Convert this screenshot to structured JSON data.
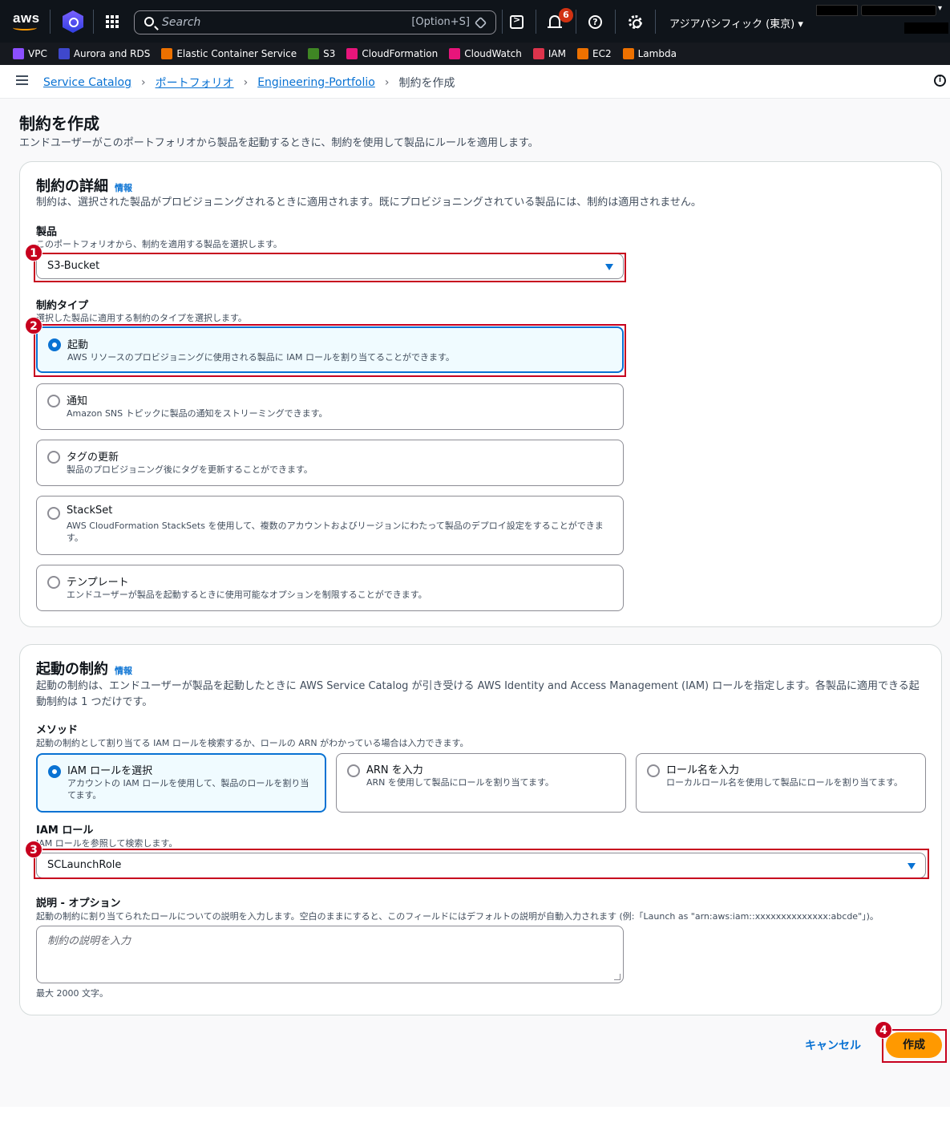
{
  "topnav": {
    "search_placeholder": "Search",
    "search_shortcut": "[Option+S]",
    "notification_count": "6",
    "region": "アジアパシフィック (東京) ▾"
  },
  "favorites": [
    {
      "label": "VPC",
      "color": "#8c4fff"
    },
    {
      "label": "Aurora and RDS",
      "color": "#3f48cc"
    },
    {
      "label": "Elastic Container Service",
      "color": "#ed7100"
    },
    {
      "label": "S3",
      "color": "#3f8624"
    },
    {
      "label": "CloudFormation",
      "color": "#e7157b"
    },
    {
      "label": "CloudWatch",
      "color": "#e7157b"
    },
    {
      "label": "IAM",
      "color": "#dd344c"
    },
    {
      "label": "EC2",
      "color": "#ed7100"
    },
    {
      "label": "Lambda",
      "color": "#ed7100"
    }
  ],
  "breadcrumb": {
    "item1": "Service Catalog",
    "item2": "ポートフォリオ",
    "item3": "Engineering-Portfolio",
    "current": "制約を作成"
  },
  "page": {
    "title": "制約を作成",
    "description": "エンドユーザーがこのポートフォリオから製品を起動するときに、制約を使用して製品にルールを適用します。"
  },
  "details": {
    "heading": "制約の詳細",
    "info": "情報",
    "description": "制約は、選択された製品がプロビジョニングされるときに適用されます。既にプロビジョニングされている製品には、制約は適用されません。",
    "product_label": "製品",
    "product_sublabel": "このポートフォリオから、制約を適用する製品を選択します。",
    "product_value": "S3-Bucket",
    "type_label": "制約タイプ",
    "type_sublabel": "選択した製品に適用する制約のタイプを選択します。",
    "types": [
      {
        "title": "起動",
        "desc": "AWS リソースのプロビジョニングに使用される製品に IAM ロールを割り当てることができます。"
      },
      {
        "title": "通知",
        "desc": "Amazon SNS トピックに製品の通知をストリーミングできます。"
      },
      {
        "title": "タグの更新",
        "desc": "製品のプロビジョニング後にタグを更新することができます。"
      },
      {
        "title": "StackSet",
        "desc": "AWS CloudFormation StackSets を使用して、複数のアカウントおよびリージョンにわたって製品のデプロイ設定をすることができます。"
      },
      {
        "title": "テンプレート",
        "desc": "エンドユーザーが製品を起動するときに使用可能なオプションを制限することができます。"
      }
    ]
  },
  "launch": {
    "heading": "起動の制約",
    "info": "情報",
    "description": "起動の制約は、エンドユーザーが製品を起動したときに AWS Service Catalog が引き受ける AWS Identity and Access Management (IAM) ロールを指定します。各製品に適用できる起動制約は 1 つだけです。",
    "method_label": "メソッド",
    "method_sublabel": "起動の制約として割り当てる IAM ロールを検索するか、ロールの ARN がわかっている場合は入力できます。",
    "methods": [
      {
        "title": "IAM ロールを選択",
        "desc": "アカウントの IAM ロールを使用して、製品のロールを割り当てます。"
      },
      {
        "title": "ARN を入力",
        "desc": "ARN を使用して製品にロールを割り当てます。"
      },
      {
        "title": "ロール名を入力",
        "desc": "ローカルロール名を使用して製品にロールを割り当てます。"
      }
    ],
    "role_label": "IAM ロール",
    "role_sublabel": "IAM ロールを参照して検索します。",
    "role_value": "SCLaunchRole",
    "desc_label": "説明 - オプション",
    "desc_sublabel": "起動の制約に割り当てられたロールについての説明を入力します。空白のままにすると、このフィールドにはデフォルトの説明が自動入力されます (例:「Launch as \"arn:aws:iam::xxxxxxxxxxxxxx:abcde\"」)。",
    "desc_placeholder": "制約の説明を入力",
    "desc_hint": "最大 2000 文字。"
  },
  "actions": {
    "cancel": "キャンセル",
    "create": "作成"
  },
  "annotations": [
    "1",
    "2",
    "3",
    "4"
  ]
}
